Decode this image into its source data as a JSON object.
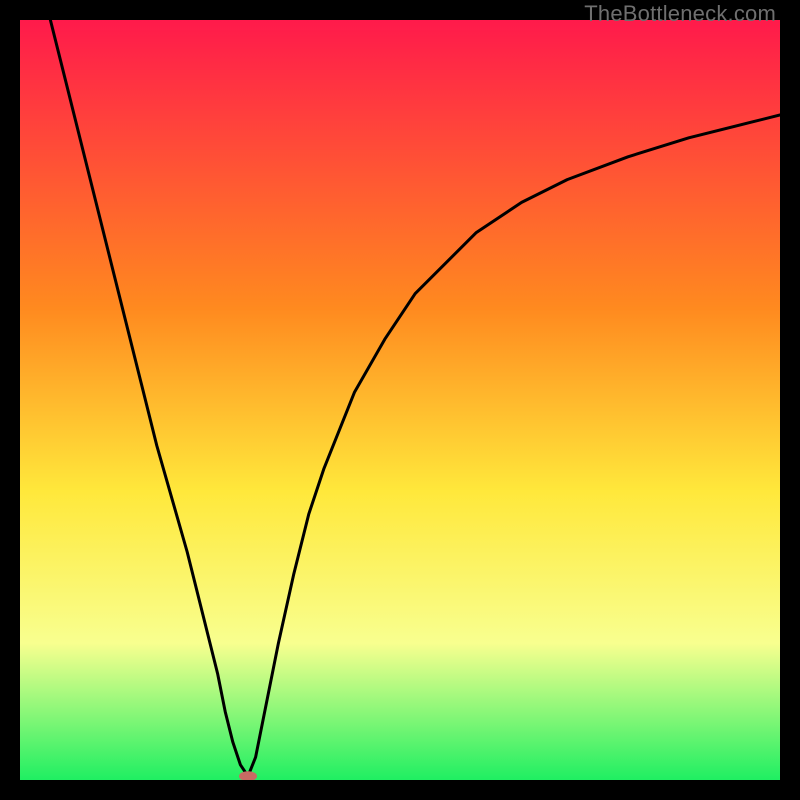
{
  "watermark": "TheBottleneck.com",
  "chart_data": {
    "type": "line",
    "title": "",
    "xlabel": "",
    "ylabel": "",
    "xlim": [
      0,
      100
    ],
    "ylim": [
      0,
      100
    ],
    "grid": false,
    "legend": false,
    "background_gradient": {
      "top": "#ff1a4b",
      "mid1": "#ff8a1f",
      "mid2": "#ffe83b",
      "mid3": "#f8ff8f",
      "bottom": "#1fef62"
    },
    "series": [
      {
        "name": "bottleneck-curve",
        "x": [
          4,
          6,
          8,
          10,
          12,
          14,
          16,
          18,
          20,
          22,
          24,
          26,
          27,
          28,
          29,
          30,
          31,
          32,
          34,
          36,
          38,
          40,
          44,
          48,
          52,
          56,
          60,
          66,
          72,
          80,
          88,
          96,
          100
        ],
        "y": [
          100,
          92,
          84,
          76,
          68,
          60,
          52,
          44,
          37,
          30,
          22,
          14,
          9,
          5,
          2,
          0.5,
          3,
          8,
          18,
          27,
          35,
          41,
          51,
          58,
          64,
          68,
          72,
          76,
          79,
          82,
          84.5,
          86.5,
          87.5
        ]
      }
    ],
    "marker": {
      "name": "optimal-point",
      "x": 30,
      "y": 0.5,
      "color": "#c96a63",
      "rx": 9,
      "ry": 5
    }
  }
}
